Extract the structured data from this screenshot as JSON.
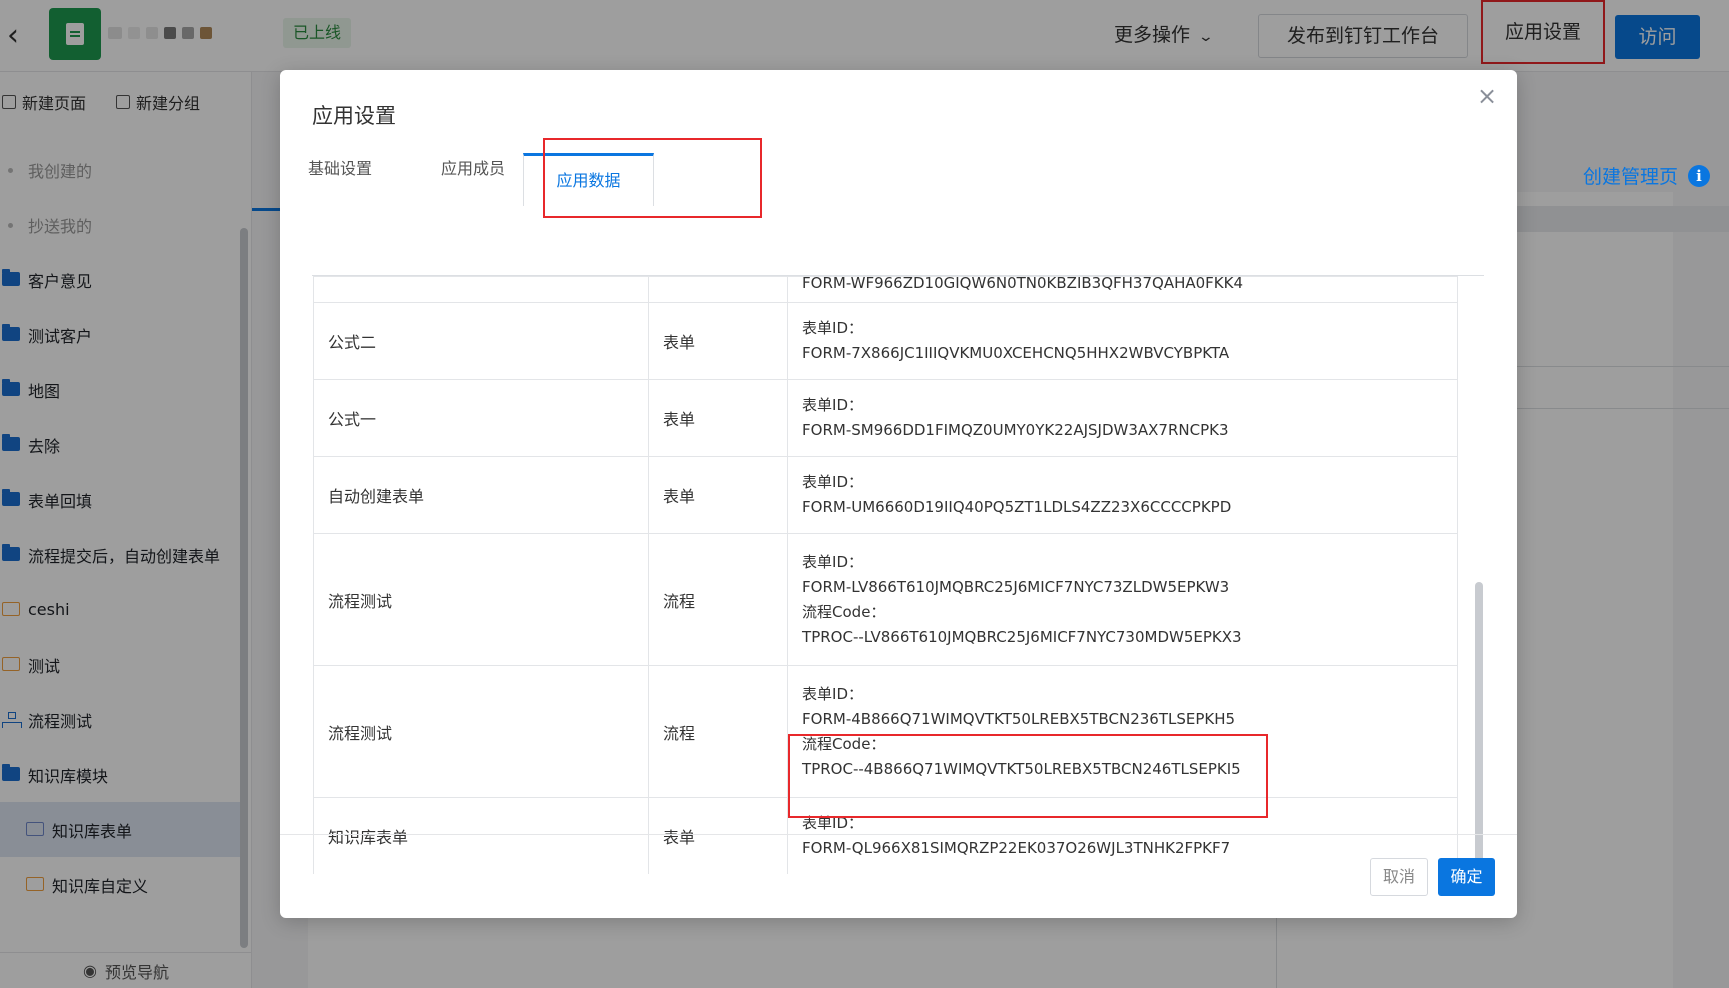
{
  "header": {
    "back_icon": "chevron-left-icon",
    "status": "已上线",
    "more_actions": "更多操作",
    "publish": "发布到钉钉工作台",
    "settings": "应用设置",
    "visit": "访问",
    "accent_color": "#0a76e0"
  },
  "sidebar": {
    "new_page": "新建页面",
    "new_group": "新建分组",
    "items": [
      {
        "label": "我创建的"
      },
      {
        "label": "抄送我的"
      },
      {
        "label": "客户意见"
      },
      {
        "label": "测试客户"
      },
      {
        "label": "地图"
      },
      {
        "label": "去除"
      },
      {
        "label": "表单回填"
      },
      {
        "label": "流程提交后，自动创建表单"
      },
      {
        "label": "ceshi"
      },
      {
        "label": "测试"
      },
      {
        "label": "流程测试"
      },
      {
        "label": "知识库模块"
      },
      {
        "label": "知识库表单"
      },
      {
        "label": "知识库自定义"
      }
    ],
    "preview_nav": "预览导航"
  },
  "canvas": {
    "create_admin": "创建管理页"
  },
  "modal": {
    "title": "应用设置",
    "tabs": [
      "基础设置",
      "应用成员",
      "应用数据"
    ],
    "active_tab": "应用数据",
    "partial_row_text": "FORM-WF966ZD10GIQW6N0TN0KBZIB3QFH37QAHA0FKK4",
    "rows": [
      {
        "name": "公式二",
        "type": "表单",
        "form_label": "表单ID：",
        "form_id": "FORM-7X866JC1IIIQVKMU0XCEHCNQ5HHX2WBVCYBPKTA"
      },
      {
        "name": "公式一",
        "type": "表单",
        "form_label": "表单ID：",
        "form_id": "FORM-SM966DD1FIMQZ0UMY0YK22AJSJDW3AX7RNCPK3"
      },
      {
        "name": "自动创建表单",
        "type": "表单",
        "form_label": "表单ID：",
        "form_id": "FORM-UM6660D19IIQ40PQ5ZT1LDLS4ZZ23X6CCCCPKPD"
      },
      {
        "name": "流程测试",
        "type": "流程",
        "form_label": "表单ID：",
        "form_id": "FORM-LV866T610JMQBRC25J6MICF7NYC73ZLDW5EPKW3",
        "code_label": "流程Code：",
        "code": "TPROC--LV866T610JMQBRC25J6MICF7NYC730MDW5EPKX3"
      },
      {
        "name": "流程测试",
        "type": "流程",
        "form_label": "表单ID：",
        "form_id": "FORM-4B866Q71WIMQVTKT50LREBX5TBCN236TLSEPKH5",
        "code_label": "流程Code：",
        "code": "TPROC--4B866Q71WIMQVTKT50LREBX5TBCN246TLSEPKI5"
      },
      {
        "name": "知识库表单",
        "type": "表单",
        "form_label": "表单ID：",
        "form_id": "FORM-QL966X81SIMQRZP22EK037O26WJL3TNHK2FPKF7"
      }
    ],
    "cancel": "取消",
    "ok": "确定"
  }
}
